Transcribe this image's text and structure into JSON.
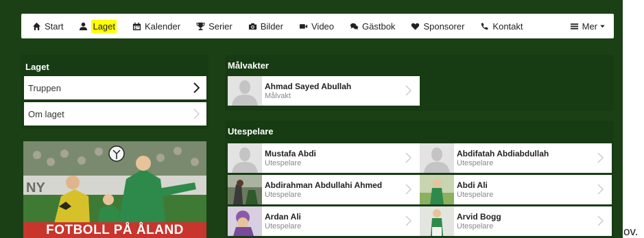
{
  "nav": {
    "items": [
      {
        "label": "Start",
        "icon": "home-icon"
      },
      {
        "label": "Laget",
        "icon": "user-icon",
        "active": true
      },
      {
        "label": "Kalender",
        "icon": "calendar-icon"
      },
      {
        "label": "Serier",
        "icon": "trophy-icon"
      },
      {
        "label": "Bilder",
        "icon": "camera-icon"
      },
      {
        "label": "Video",
        "icon": "video-camera-icon"
      },
      {
        "label": "Gästbok",
        "icon": "chat-bubbles-icon"
      },
      {
        "label": "Sponsorer",
        "icon": "heart-icon"
      },
      {
        "label": "Kontakt",
        "icon": "phone-icon"
      }
    ],
    "more_label": "Mer",
    "highlight_color": "#ffff00"
  },
  "sidebar": {
    "title": "Laget",
    "items": [
      {
        "label": "Truppen"
      },
      {
        "label": "Om laget"
      }
    ]
  },
  "banner": {
    "text": "FOTBOLL PÅ ÅLAND",
    "sign_text": "NY"
  },
  "goalkeepers": {
    "title": "Målvakter",
    "players": [
      {
        "name": "Ahmad Sayed Abullah",
        "role": "Målvakt"
      }
    ]
  },
  "outfield": {
    "title": "Utespelare",
    "players": [
      {
        "name": "Mustafa Abdi",
        "role": "Utespelare"
      },
      {
        "name": "Abdifatah Abdiabdullah",
        "role": "Utespelare"
      },
      {
        "name": "Abdirahman Abdullahi Ahmed",
        "role": "Utespelare"
      },
      {
        "name": "Abdi Ali",
        "role": "Utespelare"
      },
      {
        "name": "Ardan Ali",
        "role": "Utespelare"
      },
      {
        "name": "Arvid Bogg",
        "role": "Utespelare"
      }
    ]
  },
  "trailing_text": "ov.",
  "colors": {
    "page_bg": "#1b4016",
    "panel_bg": "#173b13"
  }
}
